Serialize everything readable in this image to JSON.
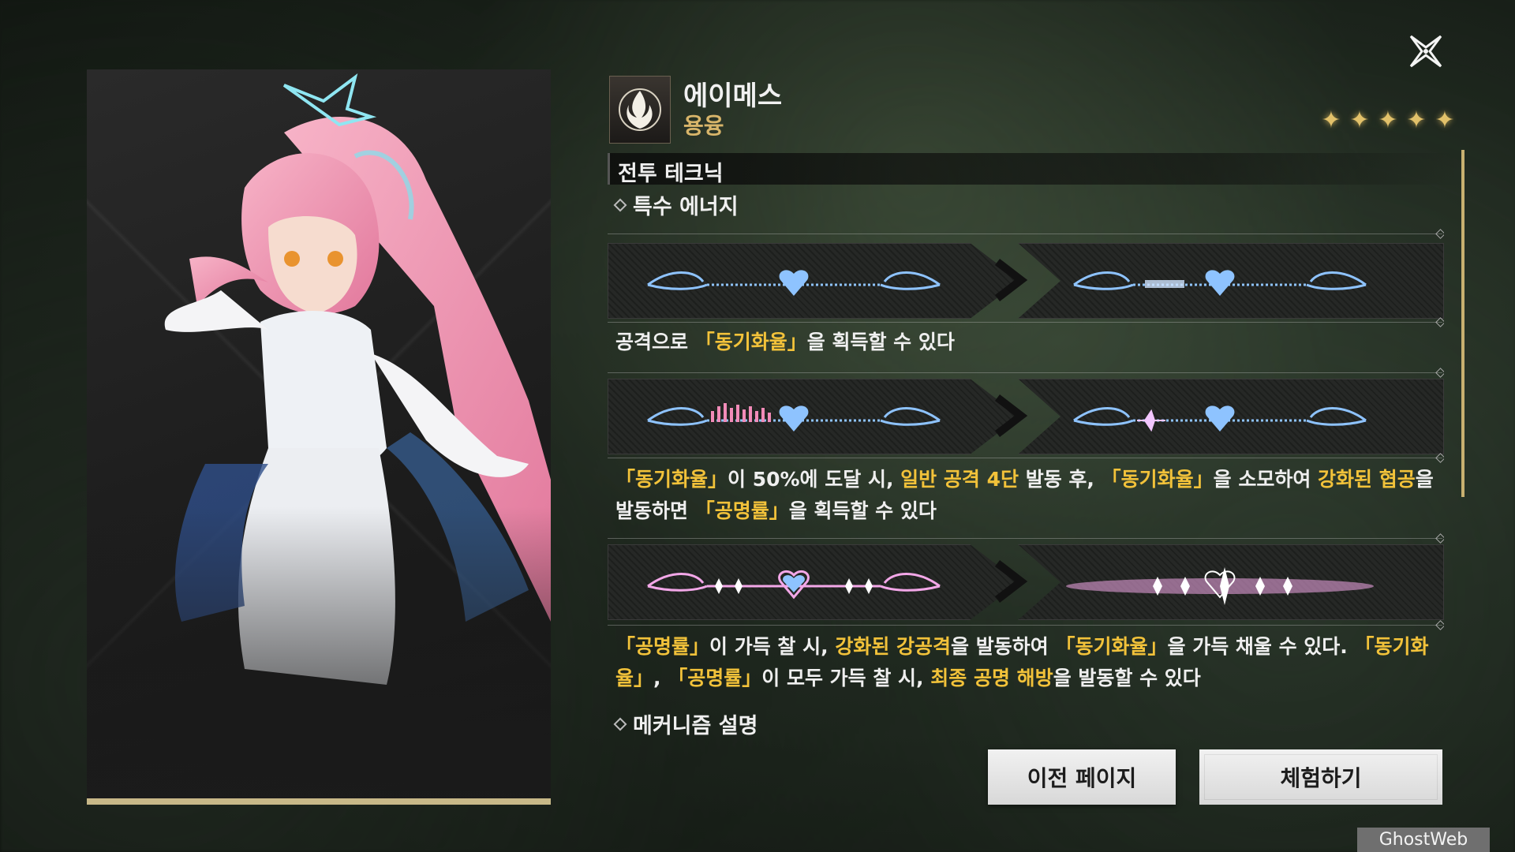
{
  "character": {
    "name": "에이메스",
    "attribute": "용융",
    "rarity_stars": 5
  },
  "section": {
    "title": "전투 테크닉",
    "subsections": [
      {
        "label": "특수 에너지"
      },
      {
        "label": "메커니즘 설명"
      }
    ]
  },
  "descriptions": [
    {
      "parts": [
        {
          "t": "공격으로 "
        },
        {
          "t": "「동기화율」",
          "hl": true
        },
        {
          "t": "을 획득할 수 있다"
        }
      ]
    },
    {
      "parts": [
        {
          "t": "「동기화율」",
          "hl": true
        },
        {
          "t": "이 50%에 도달 시, "
        },
        {
          "t": "일반 공격 4단",
          "hl": true
        },
        {
          "t": " 발동 후, "
        },
        {
          "t": "「동기화율」",
          "hl": true
        },
        {
          "t": "을 소모하여 "
        },
        {
          "t": "강화된 협공",
          "hl": true
        },
        {
          "t": "을 발동하면 "
        },
        {
          "t": "「공명률」",
          "hl": true
        },
        {
          "t": "을 획득할 수 있다"
        }
      ]
    },
    {
      "parts": [
        {
          "t": "「공명률」",
          "hl": true
        },
        {
          "t": "이 가득 찰 시, "
        },
        {
          "t": "강화된 강공격",
          "hl": true
        },
        {
          "t": "을 발동하여 "
        },
        {
          "t": "「동기화율」",
          "hl": true
        },
        {
          "t": "을 가득 채울 수 있다. "
        },
        {
          "t": "「동기화율」",
          "hl": true
        },
        {
          "t": ", "
        },
        {
          "t": "「공명률」",
          "hl": true
        },
        {
          "t": "이 모두 가득 찰 시, "
        },
        {
          "t": "최종 공명 해방",
          "hl": true
        },
        {
          "t": "을 발동할 수 있다"
        }
      ]
    }
  ],
  "buttons": {
    "prev_page": "이전 페이지",
    "try": "체험하기"
  },
  "watermark": "GhostWeb",
  "colors": {
    "highlight": "#f2c23a",
    "attribute": "#d8b56a",
    "star": "#e2c16a",
    "gauge_blue": "#8ec3ff",
    "gauge_pink": "#f3a7e8"
  },
  "icons": {
    "close": "close-x-icon",
    "emblem": "fusion-element-icon",
    "star": "star-icon"
  }
}
